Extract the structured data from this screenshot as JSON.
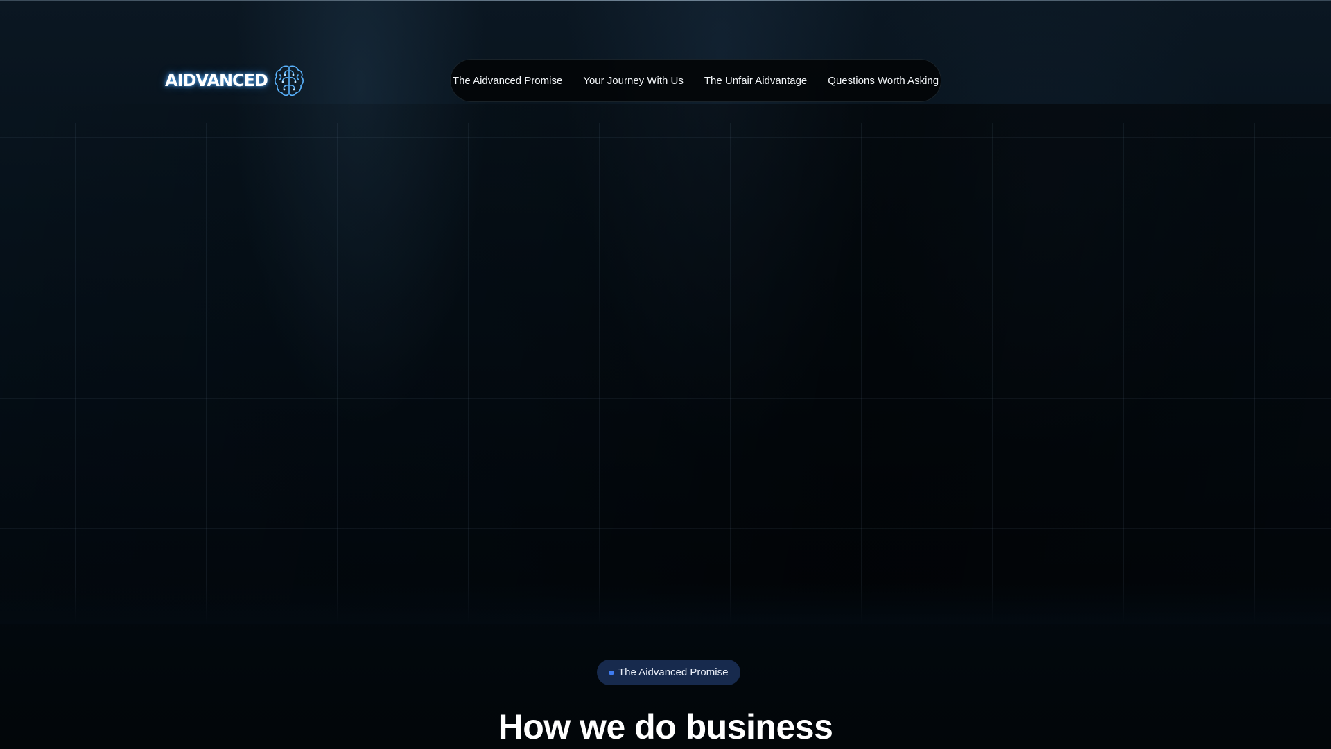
{
  "brand": {
    "logo_text": "AIDVANCED",
    "logo_icon": "brain-icon"
  },
  "nav": {
    "items": [
      {
        "label": "The Aidvanced Promise"
      },
      {
        "label": "Your Journey With Us"
      },
      {
        "label": "The Unfair Aidvantage"
      },
      {
        "label": "Questions Worth Asking"
      }
    ]
  },
  "section": {
    "badge_label": "The Aidvanced Promise",
    "heading": "How we do business"
  },
  "colors": {
    "background": "#02070c",
    "badge_bg": "#172a4d",
    "badge_dot": "#3f7cf0",
    "logo_glow": "#5ab4ff"
  }
}
